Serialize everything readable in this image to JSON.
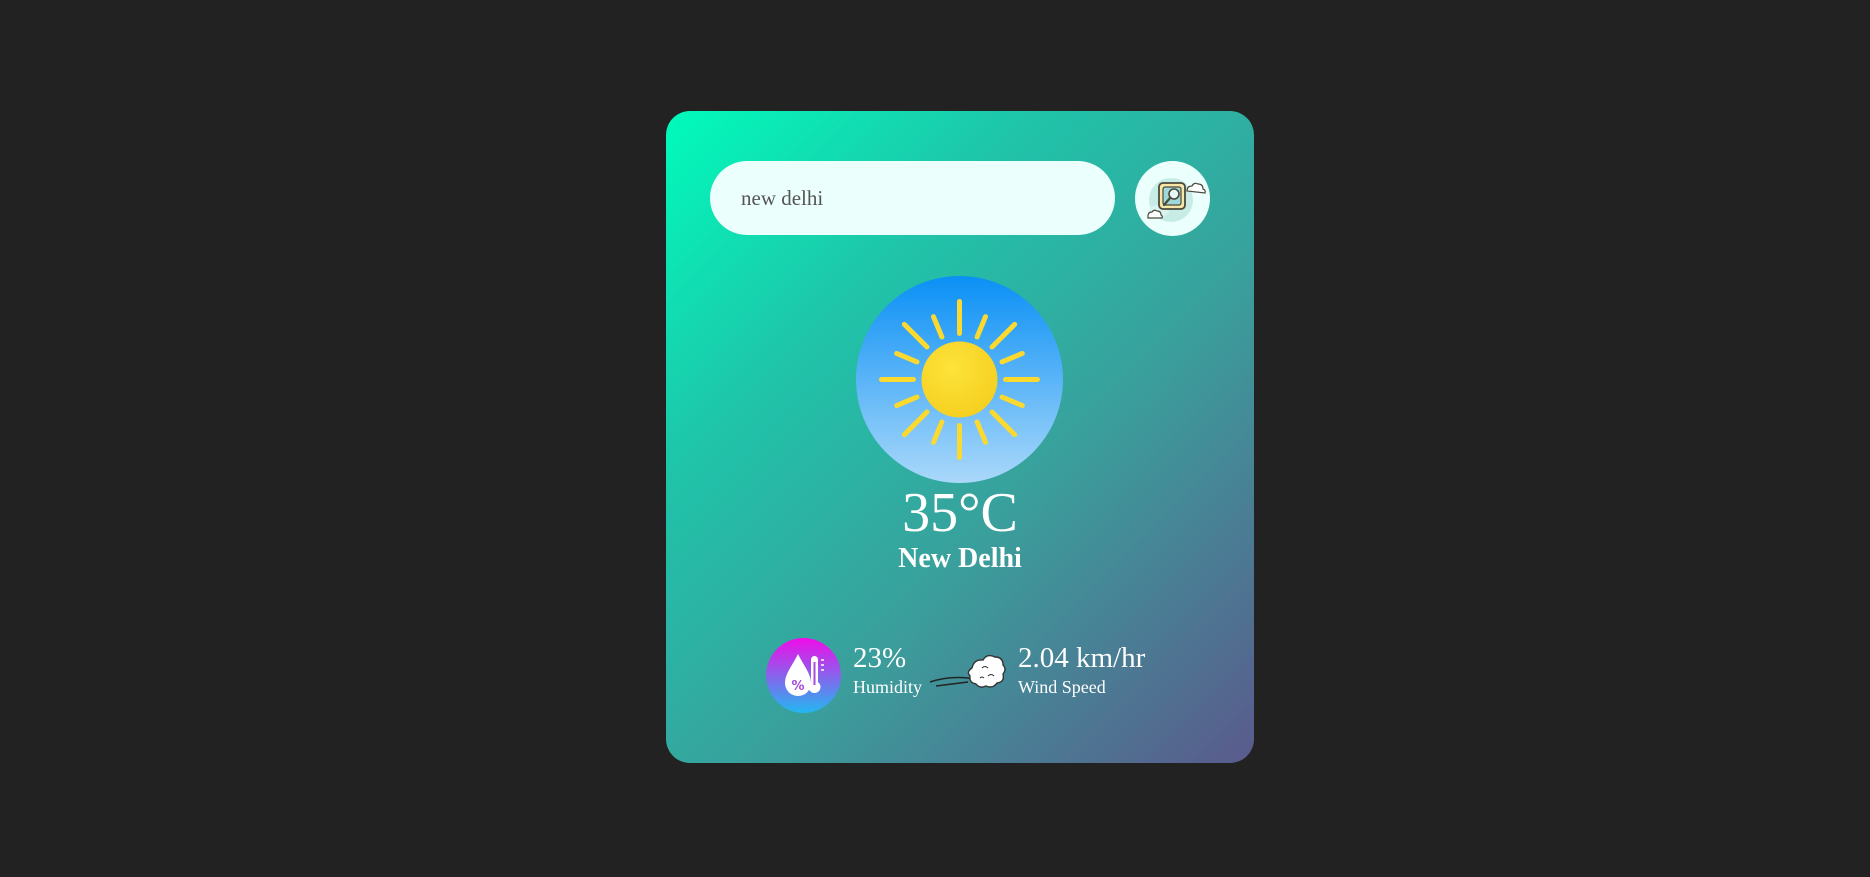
{
  "search": {
    "value": "new delhi",
    "button_icon": "search-weather-icon"
  },
  "weather": {
    "icon": "sun-icon",
    "temperature": "35°C",
    "city": "New Delhi"
  },
  "details": {
    "humidity": {
      "icon": "humidity-icon",
      "value": "23%",
      "label": "Humidity"
    },
    "wind": {
      "icon": "wind-icon",
      "value": "2.04 km/hr",
      "label": "Wind Speed"
    }
  },
  "colors": {
    "page_background": "#222222",
    "card_gradient_start": "#00fcbc",
    "card_gradient_end": "#5a5a8c",
    "input_background": "#ebfffc",
    "sun": "#fbd92f",
    "sky_top": "#0a90f5",
    "sky_bottom": "#aad8fa",
    "humidity_gradient_top": "#f00ce8",
    "humidity_gradient_bottom": "#22b8f0"
  }
}
